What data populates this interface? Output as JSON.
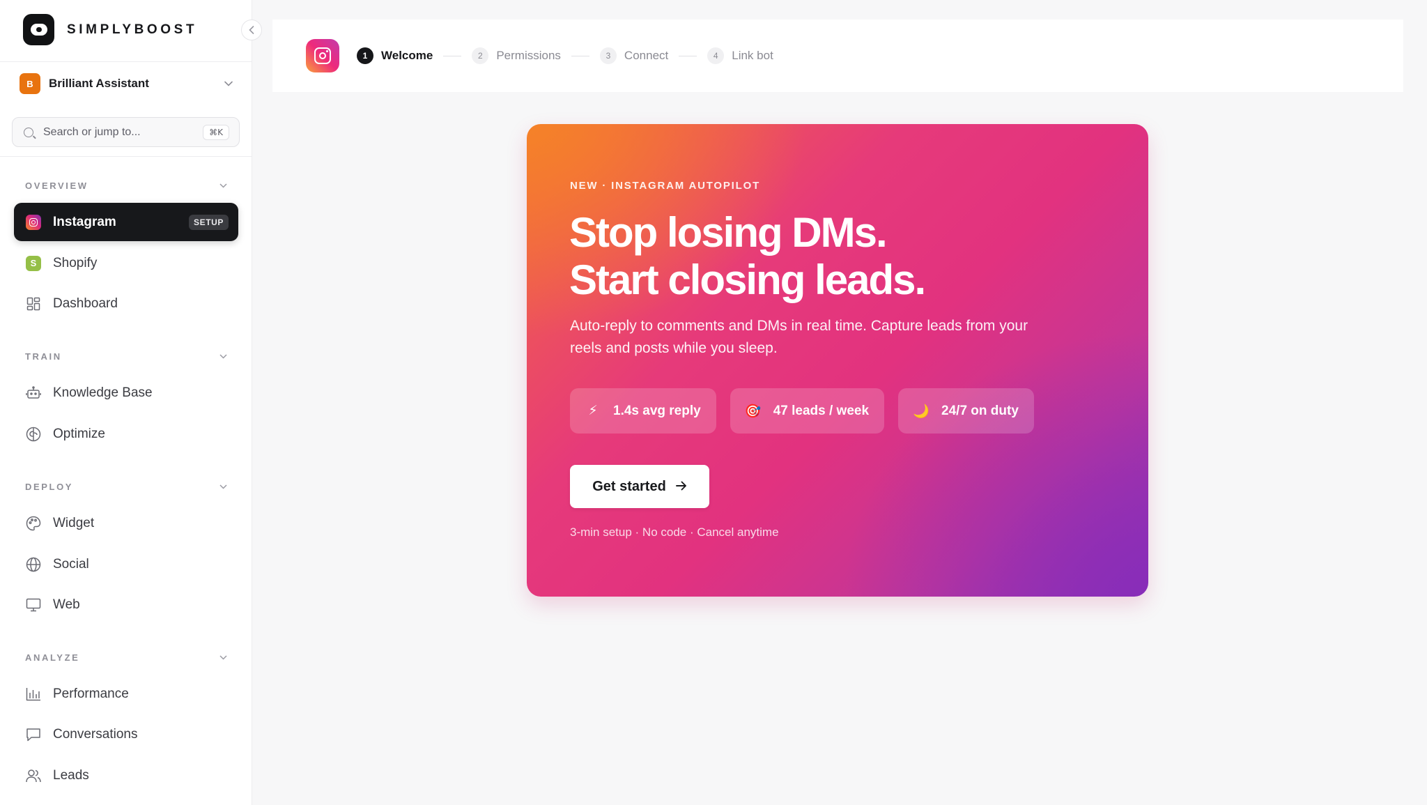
{
  "brand": {
    "name": "SIMPLYBOOST"
  },
  "workspace": {
    "initial": "B",
    "name": "Brilliant Assistant"
  },
  "search": {
    "placeholder": "Search or jump to...",
    "shortcut": "⌘K"
  },
  "sections": {
    "overview": "OVERVIEW",
    "train": "TRAIN",
    "deploy": "DEPLOY",
    "analyze": "ANALYZE"
  },
  "nav": {
    "instagram": {
      "label": "Instagram",
      "badge": "SETUP",
      "icon": "instagram-icon"
    },
    "shopify": {
      "label": "Shopify",
      "icon": "shopify-icon"
    },
    "dashboard": {
      "label": "Dashboard",
      "icon": "grid-icon"
    },
    "knowledge_base": {
      "label": "Knowledge Base",
      "icon": "robot-icon"
    },
    "optimize": {
      "label": "Optimize",
      "icon": "brain-icon"
    },
    "widget": {
      "label": "Widget",
      "icon": "palette-icon"
    },
    "social": {
      "label": "Social",
      "icon": "globe-icon"
    },
    "web": {
      "label": "Web",
      "icon": "monitor-icon"
    },
    "performance": {
      "label": "Performance",
      "icon": "bar-chart-icon"
    },
    "conversations": {
      "label": "Conversations",
      "icon": "chat-icon"
    },
    "leads": {
      "label": "Leads",
      "icon": "users-icon"
    }
  },
  "steps": [
    {
      "num": "1",
      "label": "Welcome",
      "state": "current"
    },
    {
      "num": "2",
      "label": "Permissions",
      "state": "upcoming"
    },
    {
      "num": "3",
      "label": "Connect",
      "state": "upcoming"
    },
    {
      "num": "4",
      "label": "Link bot",
      "state": "upcoming"
    }
  ],
  "hero": {
    "eyebrow": "NEW · INSTAGRAM AUTOPILOT",
    "title_line1": "Stop losing DMs.",
    "title_line2": "Start closing leads.",
    "subtitle": "Auto-reply to comments and DMs in real time. Capture leads from your reels and posts while you sleep.",
    "chips": [
      {
        "icon": "⚡",
        "label": "1.4s avg reply"
      },
      {
        "icon": "🎯",
        "label": "47 leads / week"
      },
      {
        "icon": "🌙",
        "label": "24/7 on duty"
      }
    ],
    "cta": "Get started",
    "footnote": "3-min setup · No code · Cancel anytime"
  },
  "colors": {
    "sidebar_active": "#17181b",
    "workspace_avatar": "#e8730f",
    "hero_orange": "#f46a3e",
    "hero_pink": "#e2327f",
    "hero_purple": "#8e34b5"
  }
}
